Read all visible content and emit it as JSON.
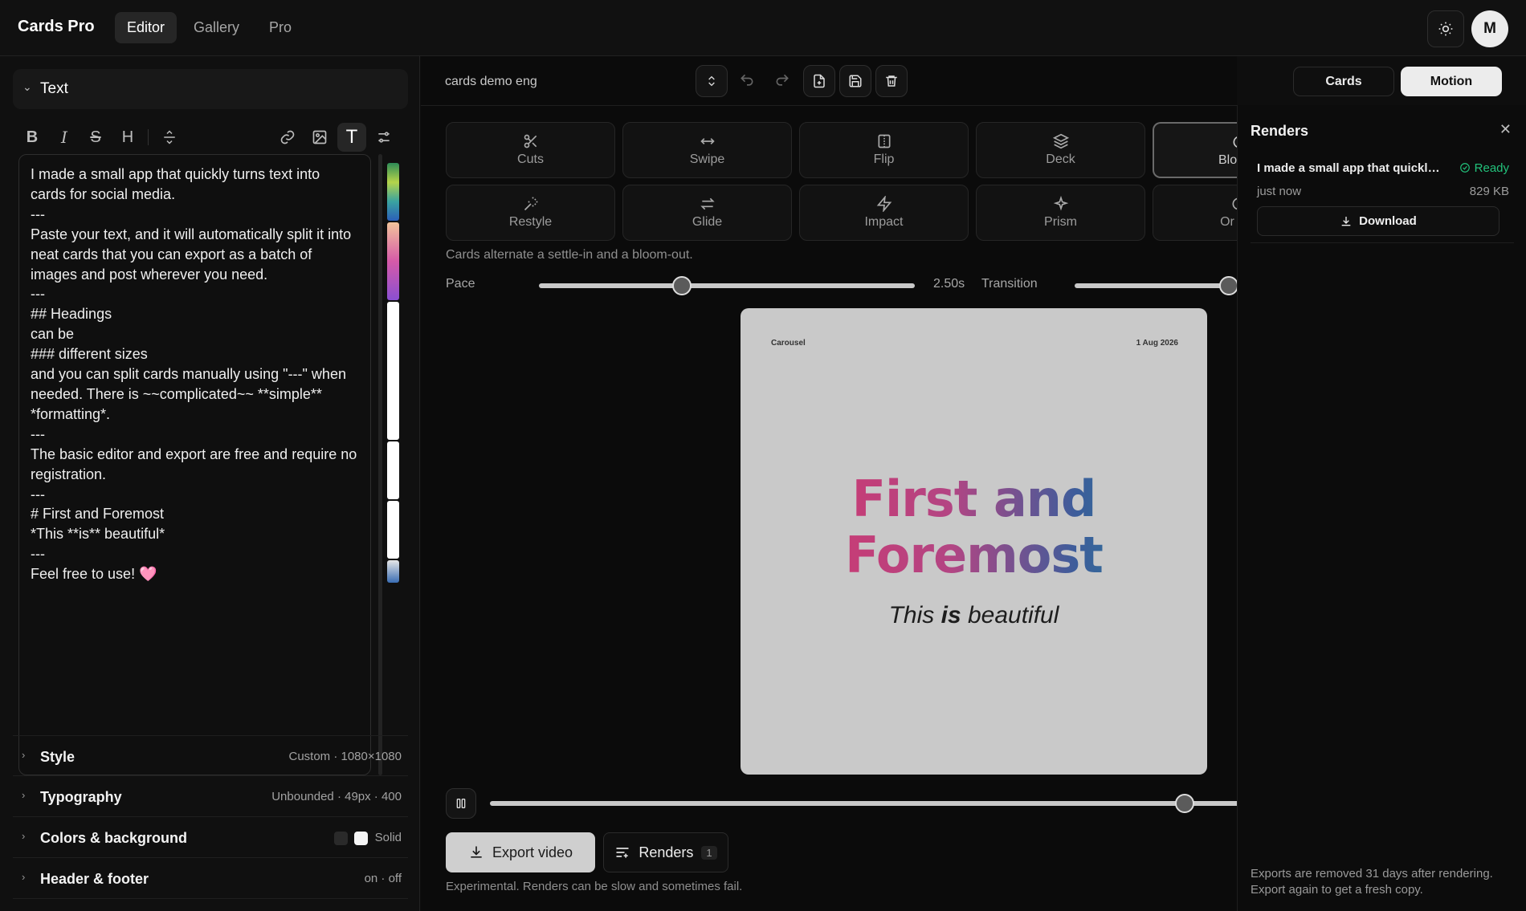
{
  "app": {
    "title": "Cards Pro",
    "tabs": [
      "Editor",
      "Gallery",
      "Pro"
    ],
    "active_tab": "Editor",
    "avatar": "M"
  },
  "left": {
    "section_title": "Text",
    "editor_text": "I made a small app that quickly turns text into cards for social media.\n---\nPaste your text, and it will automatically split it into neat cards that you can export as a batch of images and post wherever you need.\n---\n## Headings\ncan be\n### different sizes\nand you can split cards manually using \"---\" when needed. There is ~~complicated~~ **simple** *formatting*.\n---\nThe basic editor and export are free and require no registration.\n---\n# First and Foremost\n*This **is** beautiful*\n---\nFeel free to use! 🩷",
    "accordions": [
      {
        "label": "Style",
        "value": "Custom · 1080×1080"
      },
      {
        "label": "Typography",
        "value": "Unbounded · 49px · 400"
      },
      {
        "label": "Colors & background",
        "value": "Solid"
      },
      {
        "label": "Header & footer",
        "value": "on · off"
      }
    ]
  },
  "center": {
    "doc_name": "cards demo eng",
    "modes": [
      "Cards",
      "Motion"
    ],
    "active_mode": "Motion",
    "effects_row1": [
      "Cuts",
      "Swipe",
      "Flip",
      "Deck",
      "Blo"
    ],
    "effects_row2": [
      "Restyle",
      "Glide",
      "Impact",
      "Prism",
      "Or"
    ],
    "selected_effect": "Blo",
    "effect_description": "Cards alternate a settle-in and a bloom-out.",
    "pace_label": "Pace",
    "pace_value": "2.50s",
    "pace_fraction": 0.38,
    "transition_label": "Transition",
    "transition_fraction": 0.95,
    "timeline_fraction": 0.93,
    "preview": {
      "corner_left": "Carousel",
      "corner_right": "1 Aug 2026",
      "heading_line1": "First and",
      "heading_line2": "Foremost",
      "sub_pre": "This ",
      "sub_bold": "is",
      "sub_post": " beautiful"
    },
    "export_label": "Export video",
    "renders_label": "Renders",
    "renders_count": "1",
    "footnote": "Experimental. Renders can be slow and sometimes fail."
  },
  "renders": {
    "title": "Renders",
    "items": [
      {
        "name": "I made a small app that quickly turns text into cards for social media.",
        "status": "Ready",
        "time": "just now",
        "size": "829 KB",
        "download_label": "Download"
      }
    ],
    "footer": "Exports are removed 31 days after rendering. Export again to get a fresh copy."
  },
  "colors": {
    "accent_ready": "#22c27b",
    "gradient": [
      "#d8356a",
      "#b34583",
      "#3c5d9b",
      "#1d8c93"
    ]
  }
}
